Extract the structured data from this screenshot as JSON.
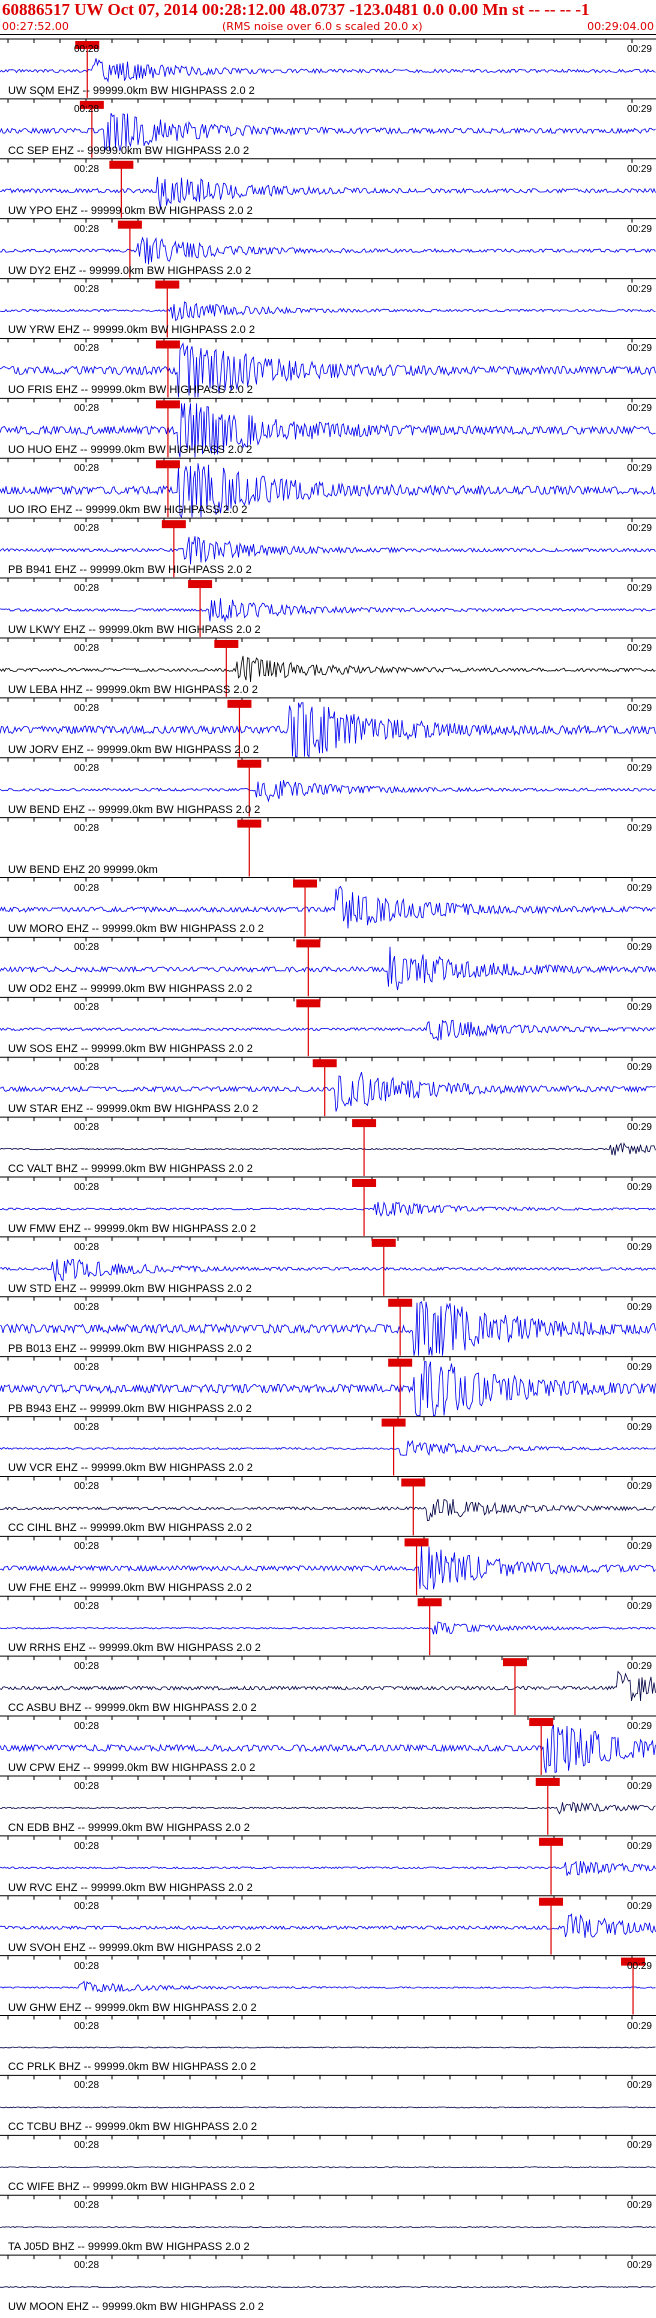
{
  "header": {
    "title": "60886517 UW Oct 07, 2014 00:28:12.00   48.0737 -123.0481  0.0 0.00 Mn st -- -- -- -1",
    "start_time": "00:27:52.00",
    "rms_note": "(RMS noise over 6.0 s scaled 20.0 x)",
    "end_time": "00:29:04.00"
  },
  "colors": {
    "accent": "#dd0000",
    "trace_blue": "#0000ee",
    "trace_dark": "#000044",
    "pick": "#dd0000"
  },
  "tick_labels": {
    "left": "00:28",
    "right": "00:29"
  },
  "traces": [
    {
      "label": "UW SQM EHZ -- 99999.0km BW  HIGHPASS  2.0  2",
      "pick": 0.133,
      "amp": 0.35,
      "color": "#0000ee",
      "burst": 0.15
    },
    {
      "label": "CC SEP EHZ -- 99999.0km BW  HIGHPASS  2.0  2",
      "pick": 0.14,
      "amp": 0.55,
      "color": "#0000ee",
      "burst": 0.17
    },
    {
      "label": "UW YPO EHZ -- 99999.0km BW  HIGHPASS  2.0  2",
      "pick": 0.185,
      "amp": 0.45,
      "color": "#0000ee",
      "burst": 0.25
    },
    {
      "label": "UW DY2 EHZ -- 99999.0km BW  HIGHPASS  2.0  2",
      "pick": 0.198,
      "amp": 0.35,
      "color": "#0000ee",
      "burst": 0.22
    },
    {
      "label": "UW YRW EHZ -- 99999.0km BW  HIGHPASS  2.0  2",
      "pick": 0.255,
      "amp": 0.25,
      "color": "#0000ee",
      "burst": 0.27
    },
    {
      "label": "UO FRIS EHZ -- 99999.0km BW  HIGHPASS  2.0  2",
      "pick": 0.256,
      "amp": 0.9,
      "color": "#0000ee",
      "burst": 0.28
    },
    {
      "label": "UO HUO EHZ -- 99999.0km BW  HIGHPASS  2.0  2",
      "pick": 0.256,
      "amp": 0.9,
      "color": "#0000ee",
      "burst": 0.28
    },
    {
      "label": "UO IRO EHZ -- 99999.0km BW  HIGHPASS  2.0  2",
      "pick": 0.256,
      "amp": 0.9,
      "color": "#0000ee",
      "burst": 0.28
    },
    {
      "label": "PB B941 EHZ -- 99999.0km BW  HIGHPASS  2.0  2",
      "pick": 0.265,
      "amp": 0.35,
      "color": "#0000ee",
      "burst": 0.29
    },
    {
      "label": "UW LKWY EHZ -- 99999.0km BW  HIGHPASS  2.0  2",
      "pick": 0.305,
      "amp": 0.3,
      "color": "#0000ee",
      "burst": 0.33
    },
    {
      "label": "UW LEBA HHZ -- 99999.0km BW  HIGHPASS  2.0  2",
      "pick": 0.345,
      "amp": 0.35,
      "color": "#000000",
      "burst": 0.37
    },
    {
      "label": "UW JORV EHZ -- 99999.0km BW  HIGHPASS  2.0  2",
      "pick": 0.365,
      "amp": 0.85,
      "color": "#0000ee",
      "burst": 0.45
    },
    {
      "label": "UW BEND EHZ -- 99999.0km BW  HIGHPASS  2.0  2",
      "pick": 0.38,
      "amp": 0.3,
      "color": "#0000ee",
      "burst": 0.4
    },
    {
      "label": "UW BEND EHZ 20 99999.0km",
      "pick": 0.38,
      "amp": 0.0,
      "color": "#0000ee",
      "burst": 0.4
    },
    {
      "label": "UW MORO EHZ -- 99999.0km BW  HIGHPASS  2.0  2",
      "pick": 0.465,
      "amp": 0.55,
      "color": "#0000ee",
      "burst": 0.52
    },
    {
      "label": "UW OD2 EHZ -- 99999.0km BW  HIGHPASS  2.0  2",
      "pick": 0.47,
      "amp": 0.55,
      "color": "#0000ee",
      "burst": 0.6
    },
    {
      "label": "UW SOS EHZ -- 99999.0km BW  HIGHPASS  2.0  2",
      "pick": 0.47,
      "amp": 0.3,
      "color": "#0000ee",
      "burst": 0.66
    },
    {
      "label": "UW STAR EHZ -- 99999.0km BW  HIGHPASS  2.0  2",
      "pick": 0.495,
      "amp": 0.55,
      "color": "#0000ee",
      "burst": 0.52
    },
    {
      "label": "CC VALT BHZ -- 99999.0km BW  HIGHPASS  2.0  2",
      "pick": 0.555,
      "amp": 0.15,
      "color": "#000044",
      "burst": 0.94
    },
    {
      "label": "UW FMW EHZ -- 99999.0km BW  HIGHPASS  2.0  2",
      "pick": 0.555,
      "amp": 0.2,
      "color": "#0000ee",
      "burst": 0.58
    },
    {
      "label": "UW STD EHZ -- 99999.0km BW  HIGHPASS  2.0  2",
      "pick": 0.585,
      "amp": 0.3,
      "color": "#0000ee",
      "burst": 0.09
    },
    {
      "label": "PB B013 EHZ -- 99999.0km BW  HIGHPASS  2.0  2",
      "pick": 0.61,
      "amp": 0.95,
      "color": "#0000ee",
      "burst": 0.64
    },
    {
      "label": "PB B943 EHZ -- 99999.0km BW  HIGHPASS  2.0  2",
      "pick": 0.61,
      "amp": 0.95,
      "color": "#0000ee",
      "burst": 0.64
    },
    {
      "label": "UW VCR EHZ -- 99999.0km BW  HIGHPASS  2.0  2",
      "pick": 0.6,
      "amp": 0.2,
      "color": "#0000ee",
      "burst": 0.62
    },
    {
      "label": "CC CIHL BHZ -- 99999.0km BW  HIGHPASS  2.0  2",
      "pick": 0.63,
      "amp": 0.3,
      "color": "#000044",
      "burst": 0.66
    },
    {
      "label": "UW FHE EHZ -- 99999.0km BW  HIGHPASS  2.0  2",
      "pick": 0.635,
      "amp": 0.55,
      "color": "#0000ee",
      "burst": 0.65
    },
    {
      "label": "UW RRHS EHZ -- 99999.0km BW  HIGHPASS  2.0  2",
      "pick": 0.655,
      "amp": 0.15,
      "color": "#0000ee",
      "burst": 0.67
    },
    {
      "label": "CC ASBU BHZ -- 99999.0km BW  HIGHPASS  2.0  2",
      "pick": 0.785,
      "amp": 0.4,
      "color": "#000044",
      "burst": 0.95
    },
    {
      "label": "UW CPW EHZ -- 99999.0km BW  HIGHPASS  2.0  2",
      "pick": 0.825,
      "amp": 0.7,
      "color": "#0000ee",
      "burst": 0.84
    },
    {
      "label": "CN EDB BHZ -- 99999.0km BW  HIGHPASS  2.0  2",
      "pick": 0.835,
      "amp": 0.15,
      "color": "#000044",
      "burst": 0.86
    },
    {
      "label": "UW RVC EHZ -- 99999.0km BW  HIGHPASS  2.0  2",
      "pick": 0.84,
      "amp": 0.2,
      "color": "#0000ee",
      "burst": 0.87
    },
    {
      "label": "UW SVOH EHZ -- 99999.0km BW  HIGHPASS  2.0  2",
      "pick": 0.84,
      "amp": 0.35,
      "color": "#0000ee",
      "burst": 0.87
    },
    {
      "label": "UW GHW EHZ -- 99999.0km BW  HIGHPASS  2.0  2",
      "pick": 0.965,
      "amp": 0.15,
      "color": "#0000ee",
      "burst": 0.13
    },
    {
      "label": "CC PRLK BHZ -- 99999.0km BW  HIGHPASS  2.0  2",
      "pick": null,
      "amp": 0.1,
      "color": "#000044",
      "burst": null
    },
    {
      "label": "CC TCBU BHZ -- 99999.0km BW  HIGHPASS  2.0  2",
      "pick": null,
      "amp": 0.1,
      "color": "#000044",
      "burst": null
    },
    {
      "label": "CC WIFE BHZ -- 99999.0km BW  HIGHPASS  2.0  2",
      "pick": null,
      "amp": 0.1,
      "color": "#000044",
      "burst": null
    },
    {
      "label": "TA J05D BHZ -- 99999.0km BW  HIGHPASS  2.0  2",
      "pick": null,
      "amp": 0.1,
      "color": "#000044",
      "burst": null
    },
    {
      "label": "UW MOON EHZ -- 99999.0km BW  HIGHPASS  2.0  2",
      "pick": null,
      "amp": 0.1,
      "color": "#000044",
      "burst": null
    }
  ]
}
